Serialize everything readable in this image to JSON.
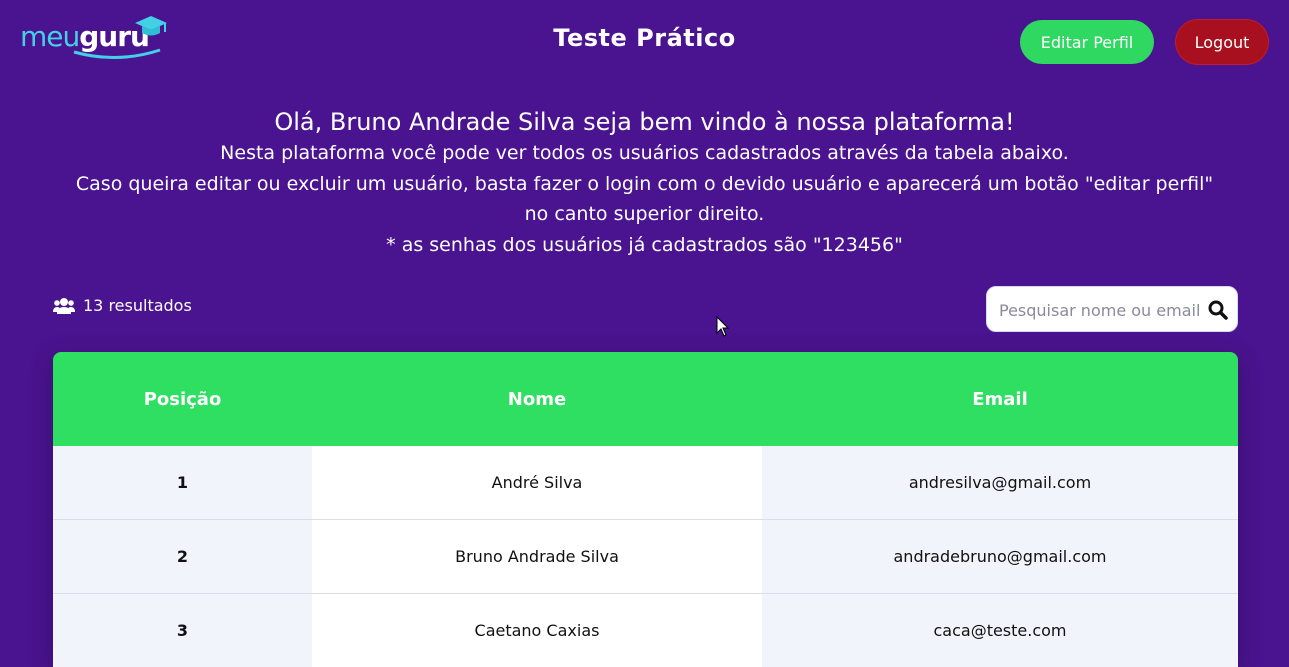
{
  "header": {
    "logo_light": "meu",
    "logo_bold": "guru",
    "title": "Teste Prático",
    "edit_profile_label": "Editar Perfil",
    "logout_label": "Logout"
  },
  "intro": {
    "greeting": "Olá, Bruno Andrade Silva seja bem vindo à nossa plataforma!",
    "line1": "Nesta plataforma você pode ver todos os usuários cadastrados através da tabela abaixo.",
    "line2": "Caso queira editar ou excluir um usuário, basta fazer o login com o devido usuário e aparecerá um botão \"editar perfil\"",
    "line3": "no canto superior direito.",
    "line4": "* as senhas dos usuários já cadastrados são \"123456\""
  },
  "toolbar": {
    "results_text": "13 resultados",
    "search_placeholder": "Pesquisar nome ou email"
  },
  "table": {
    "headers": [
      "Posição",
      "Nome",
      "Email"
    ],
    "rows": [
      {
        "position": "1",
        "name": "André Silva",
        "email": "andresilva@gmail.com"
      },
      {
        "position": "2",
        "name": "Bruno Andrade Silva",
        "email": "andradebruno@gmail.com"
      },
      {
        "position": "3",
        "name": "Caetano Caxias",
        "email": "caca@teste.com"
      }
    ]
  },
  "colors": {
    "background": "#4a138f",
    "accent_green": "#2fd961",
    "logout_red": "#a8101f",
    "logo_cyan": "#43d0e6"
  },
  "icons": {
    "logo": "graduation-cap-icon",
    "results": "users-icon",
    "search": "search-icon",
    "cursor": "mouse-pointer-icon"
  }
}
